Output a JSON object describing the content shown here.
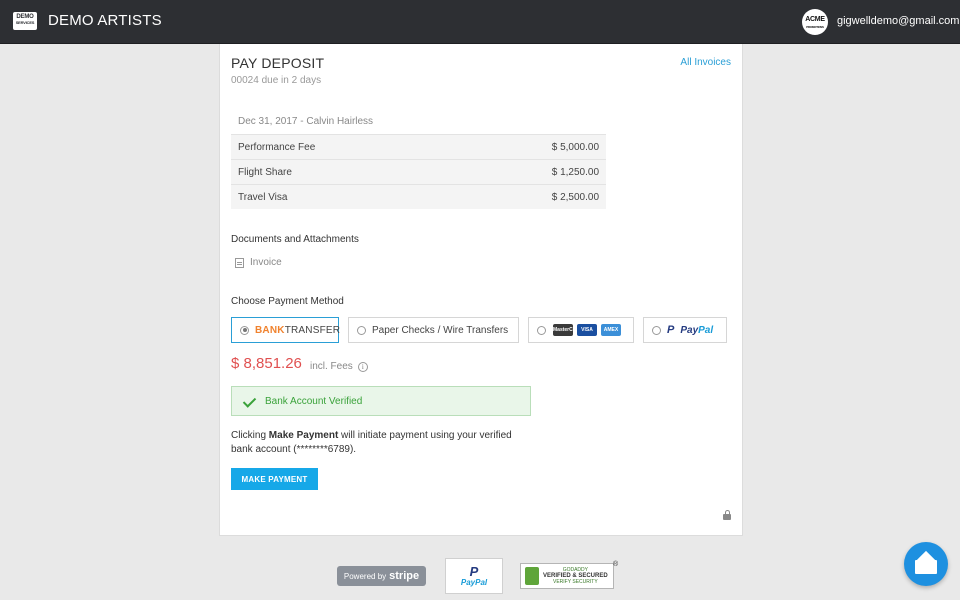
{
  "header": {
    "logo_top": "DEMO",
    "logo_bottom": "SERVICES",
    "brand_name": "DEMO ARTISTS",
    "avatar_top": "ACME",
    "avatar_bottom": "PROMOTIONS",
    "user_email": "gigwelldemo@gmail.com"
  },
  "invoice": {
    "title": "PAY DEPOSIT",
    "due": "00024 due in 2 days",
    "all_invoices_link": "All Invoices",
    "date_line": "Dec 31, 2017 - Calvin Hairless",
    "items": [
      {
        "label": "Performance Fee",
        "amount": "$ 5,000.00"
      },
      {
        "label": "Flight Share",
        "amount": "$ 1,250.00"
      },
      {
        "label": "Travel Visa",
        "amount": "$ 2,500.00"
      }
    ]
  },
  "documents": {
    "heading": "Documents and Attachments",
    "files": [
      "Invoice"
    ]
  },
  "payment": {
    "heading": "Choose Payment Method",
    "bank_transfer_part1": "BANK",
    "bank_transfer_part2": "TRANSFER",
    "checks_label": "Paper Checks / Wire Transfers",
    "card_logos": [
      "MasterCard",
      "VISA",
      "AMEX"
    ],
    "paypal_part1": "Pay",
    "paypal_part2": "Pal",
    "selected": "bank_transfer",
    "amount": "$ 8,851.26",
    "fees_note": "incl. Fees",
    "verified_message": "Bank Account Verified",
    "notice_part1": "Clicking ",
    "notice_bold": "Make Payment",
    "notice_part2": " will initiate payment using your verified bank account (********6789).",
    "make_payment_button": "MAKE PAYMENT"
  },
  "footer": {
    "stripe_prefix": "Powered by",
    "stripe_name": "stripe",
    "paypal_badge": "PayPal",
    "godaddy_brand": "GODADDY",
    "godaddy_main": "VERIFIED & SECURED",
    "godaddy_sub": "VERIFY SECURITY"
  },
  "colors": {
    "topbar": "#2d2f33",
    "accent": "#2a9fd6",
    "amount": "#e05050",
    "success": "#3aa23a",
    "button": "#16a8e8"
  }
}
